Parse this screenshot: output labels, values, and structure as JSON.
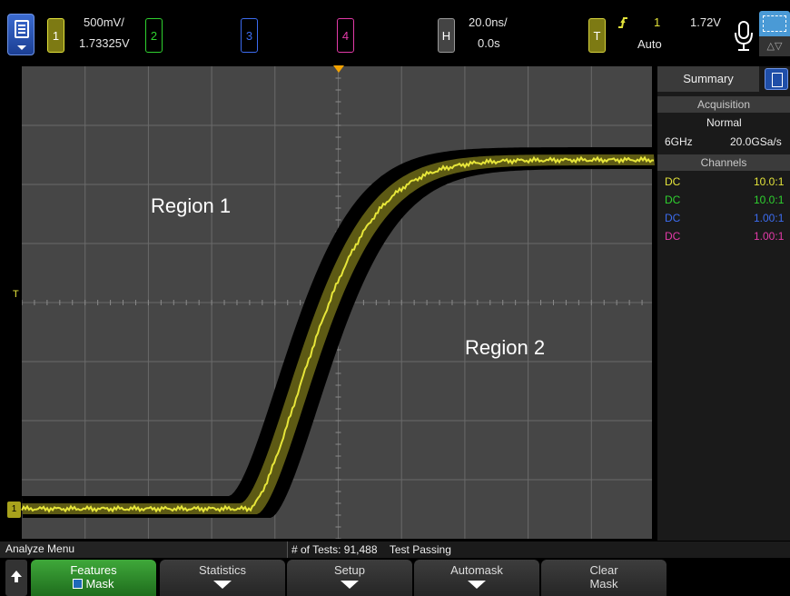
{
  "topbar": {
    "ch1": {
      "label": "1",
      "scale": "500mV/",
      "offset": "1.73325V",
      "color": "#e3e33a"
    },
    "ch2": {
      "label": "2",
      "color": "#2fd12f"
    },
    "ch3": {
      "label": "3",
      "color": "#3c6cf0"
    },
    "ch4": {
      "label": "4",
      "color": "#e33aa8"
    },
    "horizontal": {
      "label": "H",
      "timebase": "20.0ns/",
      "delay": "0.0s"
    },
    "trigger": {
      "label": "T",
      "slope_icon": "rising-edge-icon",
      "source": "1",
      "level": "1.72V",
      "mode": "Auto"
    },
    "touch_icon_text": "△▽"
  },
  "graticule": {
    "region1_label": "Region 1",
    "region2_label": "Region 2",
    "trigger_marker_label": "T",
    "ch1_ground_label": "1"
  },
  "panel": {
    "tab_label": "Summary",
    "acquisition_header": "Acquisition",
    "acq_mode": "Normal",
    "bandwidth": "6GHz",
    "sample_rate": "20.0GSa/s",
    "channels_header": "Channels",
    "channels": [
      {
        "coupling": "DC",
        "probe": "10.0:1",
        "color": "#e3e33a"
      },
      {
        "coupling": "DC",
        "probe": "10.0:1",
        "color": "#2fd12f"
      },
      {
        "coupling": "DC",
        "probe": "1.00:1",
        "color": "#3c6cf0"
      },
      {
        "coupling": "DC",
        "probe": "1.00:1",
        "color": "#e33aa8"
      }
    ]
  },
  "status": {
    "menu_name": "Analyze Menu",
    "tests_text": "# of Tests: 91,488",
    "result_text": "Test Passing"
  },
  "softkeys": {
    "features_label": "Features",
    "mask_label": "Mask",
    "statistics_label": "Statistics",
    "setup_label": "Setup",
    "automask_label": "Automask",
    "clear_label": "Clear",
    "clear_label2": "Mask"
  }
}
